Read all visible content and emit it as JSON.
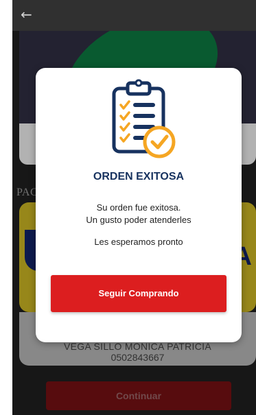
{
  "background": {
    "section_label": "PAC",
    "brand_text": "A",
    "owner_name": "VEGA SILLO MONICA PATRICIA",
    "owner_id": "0502843667",
    "continue_label": "Continuar",
    "back_icon": "arrow-left-icon"
  },
  "modal": {
    "icon": "clipboard-checklist-icon",
    "title": "ORDEN EXITOSA",
    "message_line1": "Su orden fue exitosa.",
    "message_line2": "Un gusto poder atenderles",
    "message_line3": "Les esperamos pronto",
    "button_label": "Seguir Comprando"
  },
  "colors": {
    "title": "#17325f",
    "button": "#dc1e1f",
    "check_orange": "#f5a623"
  }
}
